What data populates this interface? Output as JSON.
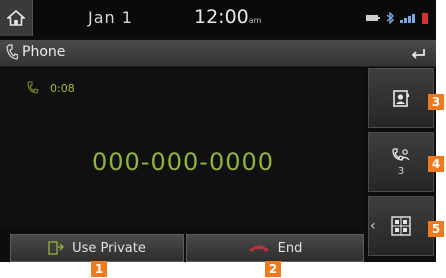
{
  "status": {
    "date": "Jan  1",
    "time": "12:00",
    "time_suffix": "am"
  },
  "titlebar": {
    "title": "Phone",
    "icon": "phone-icon",
    "back_icon": "back-arrow-icon"
  },
  "call": {
    "duration": "0:08",
    "number": "000-000-0000"
  },
  "sidebar": {
    "contacts_icon": "contacts-icon",
    "participants_icon": "participants-icon",
    "participants_count": "3",
    "keypad_icon": "keypad-icon",
    "more_icon": "chevron-left-icon"
  },
  "bottom": {
    "use_private_label": "Use Private",
    "end_label": "End"
  },
  "badges": [
    "1",
    "2",
    "3",
    "4",
    "5"
  ],
  "colors": {
    "accent_green": "#8fb43a",
    "badge_orange": "#f07a1c",
    "end_red": "#c0303a"
  }
}
